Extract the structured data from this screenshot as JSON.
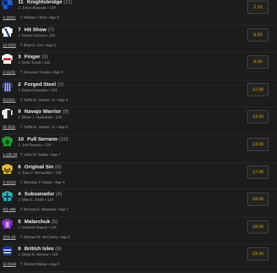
{
  "runners": [
    {
      "program": "11",
      "name": "Knightsbridge",
      "draw": "(11)",
      "jockey_line": "J: Junior Alvarado • 124",
      "form": "1-11621",
      "trainer_line": "T: William I. Mott • Age 5",
      "odds": "2.10",
      "silk": {
        "primary": "#1f5fd0",
        "secondary": "#0a1e60",
        "pattern": "quarters"
      }
    },
    {
      "program": "7",
      "name": "Hit Show",
      "draw": "(7)",
      "jockey_line": "J: Florent Geroux • 124",
      "form": "12-1532",
      "trainer_line": "T: Brad H. Cox • Age 6",
      "odds": "6.50",
      "silk": {
        "primary": "#ffffff",
        "secondary": "#1a3a8a",
        "pattern": "sash"
      }
    },
    {
      "program": "3",
      "name": "Finger",
      "draw": "(3)",
      "jockey_line": "J: Keita Tosaki • 118",
      "form": "2-11211",
      "trainer_line": "T: Hiroyasu Tanaka • Age 3",
      "odds": "8.00",
      "silk": {
        "primary": "#ffffff",
        "secondary": "#d01818",
        "pattern": "band"
      }
    },
    {
      "program": "2",
      "name": "Forged Steel",
      "draw": "(2)",
      "jockey_line": "J: Edwin Gonzalez • 124",
      "form": "813115-",
      "trainer_line": "T: Saffie A. Joseph, Jr. • Age 4",
      "odds": "12.00",
      "silk": {
        "primary": "#2a3c9a",
        "secondary": "#e8c020",
        "pattern": "stripes"
      }
    },
    {
      "program": "9",
      "name": "Navajo Warrior",
      "draw": "(9)",
      "jockey_line": "J: Micah J. Husbands • 124",
      "form": "81-3111",
      "trainer_line": "T: Saffie A. Joseph, Jr. • Age 5",
      "odds": "13.00",
      "silk": {
        "primary": "#f0f0f0",
        "secondary": "#202020",
        "pattern": "halves"
      }
    },
    {
      "program": "10",
      "name": "Full Serrano",
      "draw": "(10)",
      "jockey_line": "J: Joel Rosario • 124",
      "form": "1-125-34",
      "trainer_line": "T: John W. Sadler • Age 7",
      "odds": "13.00",
      "silk": {
        "primary": "#1e9a30",
        "secondary": "#0a4a14",
        "pattern": "diamond"
      }
    },
    {
      "program": "6",
      "name": "Original Sin",
      "draw": "(6)",
      "jockey_line": "J: Juan J. Hernandez • 124",
      "form": "3-16119",
      "trainer_line": "T: Brendan P. Walsh • Age 4",
      "odds": "17.00",
      "silk": {
        "primary": "#e8c020",
        "secondary": "#202020",
        "pattern": "chevrons"
      }
    },
    {
      "program": "4",
      "name": "Subsanador",
      "draw": "(4)",
      "jockey_line": "J: Mike E. Smith • 124",
      "form": "411-445",
      "trainer_line": "T: Richard E. Mandella • Age 7",
      "odds": "19.00",
      "silk": {
        "primary": "#30b0b0",
        "secondary": "#103060",
        "pattern": "cross"
      }
    },
    {
      "program": "5",
      "name": "Malarchuk",
      "draw": "(5)",
      "jockey_line": "J: Umberto Rispoli • 124",
      "form": "3211-22",
      "trainer_line": "T: Michael W. McCarthy • Age 5",
      "odds": "19.00",
      "silk": {
        "primary": "#8a30c0",
        "secondary": "#ffffff",
        "pattern": "body"
      }
    },
    {
      "program": "8",
      "name": "British Isles",
      "draw": "(8)",
      "jockey_line": "J: Diego A. Herrera • 124",
      "form": "12-5164",
      "trainer_line": "T: Richard Baltas • Age 5",
      "odds": "23.00",
      "silk": {
        "primary": "#1a3a8a",
        "secondary": "#ffffff",
        "pattern": "hoops"
      }
    }
  ]
}
